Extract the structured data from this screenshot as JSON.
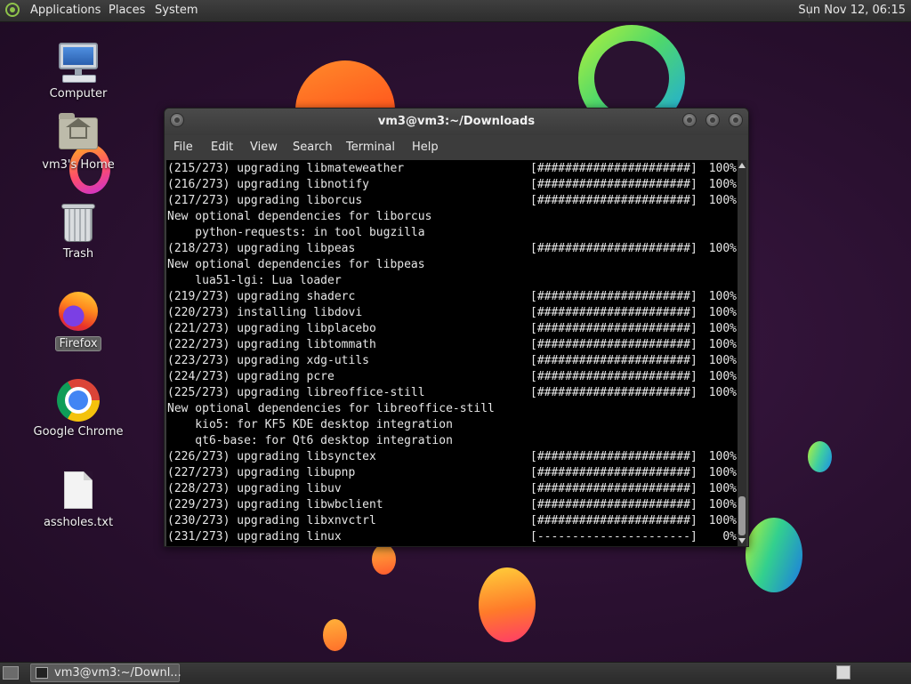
{
  "top_panel": {
    "menu": [
      "Applications",
      "Places",
      "System"
    ],
    "clock": "Sun Nov 12, 06:15"
  },
  "desktop_icons": [
    {
      "label": "Computer",
      "icon": "computer-icon"
    },
    {
      "label": "vm3's Home",
      "icon": "home-folder-icon"
    },
    {
      "label": "Trash",
      "icon": "trash-icon"
    },
    {
      "label": "Firefox",
      "icon": "firefox-icon",
      "selected": true
    },
    {
      "label": "Google Chrome",
      "icon": "chrome-icon"
    },
    {
      "label": "assholes.txt",
      "icon": "text-file-icon"
    }
  ],
  "terminal": {
    "title": "vm3@vm3:~/Downloads",
    "menu": [
      "File",
      "Edit",
      "View",
      "Search",
      "Terminal",
      "Help"
    ],
    "lines": [
      {
        "text": "(215/273) upgrading libmateweather",
        "bar": "[######################]",
        "pct": "100%"
      },
      {
        "text": "(216/273) upgrading libnotify",
        "bar": "[######################]",
        "pct": "100%"
      },
      {
        "text": "(217/273) upgrading liborcus",
        "bar": "[######################]",
        "pct": "100%"
      },
      {
        "text": "New optional dependencies for liborcus"
      },
      {
        "text": "    python-requests: in tool bugzilla"
      },
      {
        "text": "(218/273) upgrading libpeas",
        "bar": "[######################]",
        "pct": "100%"
      },
      {
        "text": "New optional dependencies for libpeas"
      },
      {
        "text": "    lua51-lgi: Lua loader"
      },
      {
        "text": "(219/273) upgrading shaderc",
        "bar": "[######################]",
        "pct": "100%"
      },
      {
        "text": "(220/273) installing libdovi",
        "bar": "[######################]",
        "pct": "100%"
      },
      {
        "text": "(221/273) upgrading libplacebo",
        "bar": "[######################]",
        "pct": "100%"
      },
      {
        "text": "(222/273) upgrading libtommath",
        "bar": "[######################]",
        "pct": "100%"
      },
      {
        "text": "(223/273) upgrading xdg-utils",
        "bar": "[######################]",
        "pct": "100%"
      },
      {
        "text": "(224/273) upgrading pcre",
        "bar": "[######################]",
        "pct": "100%"
      },
      {
        "text": "(225/273) upgrading libreoffice-still",
        "bar": "[######################]",
        "pct": "100%"
      },
      {
        "text": "New optional dependencies for libreoffice-still"
      },
      {
        "text": "    kio5: for KF5 KDE desktop integration"
      },
      {
        "text": "    qt6-base: for Qt6 desktop integration"
      },
      {
        "text": "(226/273) upgrading libsynctex",
        "bar": "[######################]",
        "pct": "100%"
      },
      {
        "text": "(227/273) upgrading libupnp",
        "bar": "[######################]",
        "pct": "100%"
      },
      {
        "text": "(228/273) upgrading libuv",
        "bar": "[######################]",
        "pct": "100%"
      },
      {
        "text": "(229/273) upgrading libwbclient",
        "bar": "[######################]",
        "pct": "100%"
      },
      {
        "text": "(230/273) upgrading libxnvctrl",
        "bar": "[######################]",
        "pct": "100%"
      },
      {
        "text": "(231/273) upgrading linux",
        "bar": "[----------------------]",
        "pct": "0%"
      }
    ]
  },
  "taskbar": {
    "tasks": [
      {
        "label": "vm3@vm3:~/Downl...",
        "icon": "terminal-icon"
      }
    ]
  },
  "colors": {
    "panel": "#2d2d2d",
    "terminal_bg": "#000000",
    "terminal_fg": "#e6e6e6",
    "os_logo": "#8ec34a"
  }
}
